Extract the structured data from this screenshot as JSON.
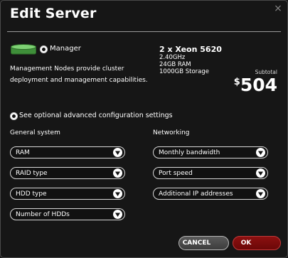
{
  "dialog": {
    "title": "Edit Server",
    "close_icon": "close-icon"
  },
  "server": {
    "icon": "server-icon",
    "type_label": "Manager",
    "type_selected": true,
    "description": "Management Nodes provide cluster deployment and management capabilities.",
    "spec_title": "2 x Xeon 5620",
    "spec_lines": [
      "2.40GHz",
      "24GB RAM",
      "1000GB Storage"
    ],
    "subtotal_label": "Subtotal",
    "currency_symbol": "$",
    "price": "504"
  },
  "advanced": {
    "label": "See optional advanced configuration settings",
    "selected": true
  },
  "general": {
    "heading": "General system",
    "dropdowns": [
      "RAM",
      "RAID type",
      "HDD type",
      "Number of HDDs"
    ]
  },
  "networking": {
    "heading": "Networking",
    "dropdowns": [
      "Monthly bandwidth",
      "Port speed",
      "Additional IP addresses"
    ]
  },
  "buttons": {
    "cancel": "CANCEL",
    "ok": "OK"
  },
  "colors": {
    "accent_red": "#7a0c0c",
    "server_icon_green": "#5fb85a"
  }
}
